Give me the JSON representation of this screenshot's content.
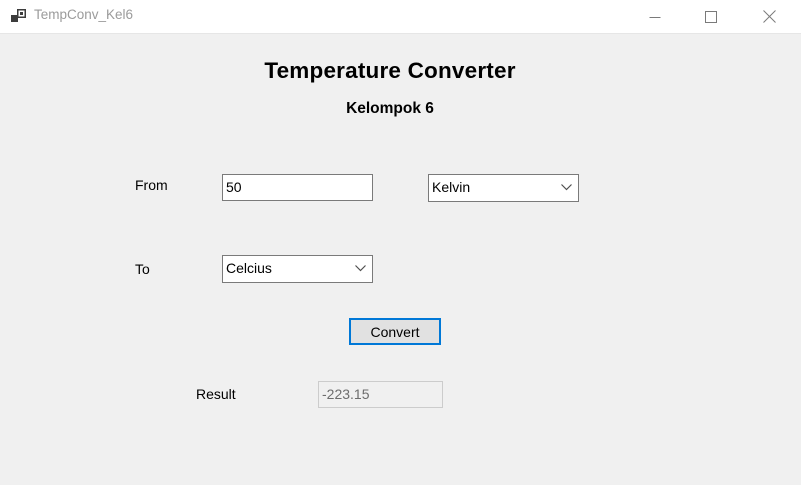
{
  "window": {
    "title": "TempConv_Kel6",
    "controls": [
      "minimize-icon",
      "maximize-icon",
      "close-icon"
    ]
  },
  "header": {
    "title": "Temperature Converter",
    "subtitle": "Kelompok 6"
  },
  "form": {
    "from_label": "From",
    "from_value": "50",
    "from_unit": "Kelvin",
    "to_label": "To",
    "to_unit": "Celcius",
    "convert_label": "Convert",
    "result_label": "Result",
    "result_value": "-223.15"
  },
  "colors": {
    "background": "#f0f0f0",
    "accent": "#0078d7"
  }
}
